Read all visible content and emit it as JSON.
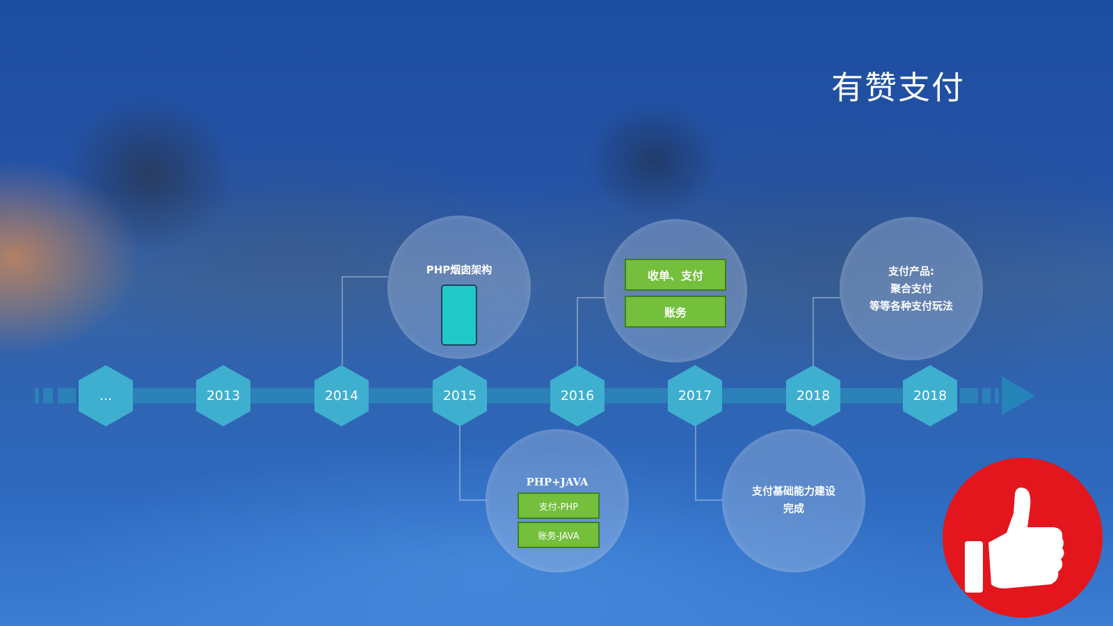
{
  "title": "有赞支付",
  "timeline": {
    "years": [
      "...",
      "2013",
      "2014",
      "2015",
      "2016",
      "2017",
      "2018",
      "2018"
    ]
  },
  "milestones": {
    "y2014_top": {
      "label": "PHP烟囱架构",
      "icon": "phone-icon"
    },
    "y2015_bottom": {
      "label": "PHP+JAVA",
      "boxes": [
        "支付-PHP",
        "账务-JAVA"
      ]
    },
    "y2016_top": {
      "boxes": [
        "收单、支付",
        "账务"
      ]
    },
    "y2017_bottom": {
      "lines": [
        "支付基础能力建设",
        "完成"
      ]
    },
    "y2018_top": {
      "lines": [
        "支付产品:",
        "聚合支付",
        "等等各种支付玩法"
      ]
    }
  },
  "badge": {
    "icon": "thumbs-up-icon",
    "color": "#e3161e"
  },
  "colors": {
    "hex": "#3fafcf",
    "axis": "#2a86b8",
    "box": "#74bf3c"
  }
}
